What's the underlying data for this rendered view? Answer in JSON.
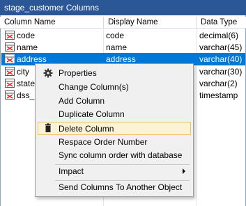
{
  "window": {
    "title": "stage_customer Columns"
  },
  "table": {
    "headers": [
      "Column Name",
      "Display Name",
      "Data Type"
    ],
    "rows": [
      {
        "name": "code",
        "display": "code",
        "type": "decimal(6)"
      },
      {
        "name": "name",
        "display": "name",
        "type": "varchar(45)"
      },
      {
        "name": "address",
        "display": "address",
        "type": "varchar(40)"
      },
      {
        "name": "city",
        "display": "",
        "type": "varchar(30)"
      },
      {
        "name": "state",
        "display": "",
        "type": "varchar(2)"
      },
      {
        "name": "dss_u",
        "display": "",
        "type": "timestamp"
      }
    ],
    "selected_index": 2
  },
  "context_menu": {
    "items": [
      {
        "label": "Properties",
        "icon": "gear-icon"
      },
      {
        "label": "Change Column(s)"
      },
      {
        "label": "Add Column"
      },
      {
        "label": "Duplicate Column"
      },
      {
        "label": "Delete Column",
        "icon": "trash-icon",
        "highlighted": true
      },
      {
        "label": "Respace Order Number"
      },
      {
        "label": "Sync column order with database"
      },
      {
        "label": "Impact",
        "submenu": true
      },
      {
        "label": "Send Columns To Another Object"
      }
    ]
  },
  "colors": {
    "title_bar": "#2b5797",
    "selection": "#0078d7",
    "menu_highlight": "#fcf3d6"
  }
}
